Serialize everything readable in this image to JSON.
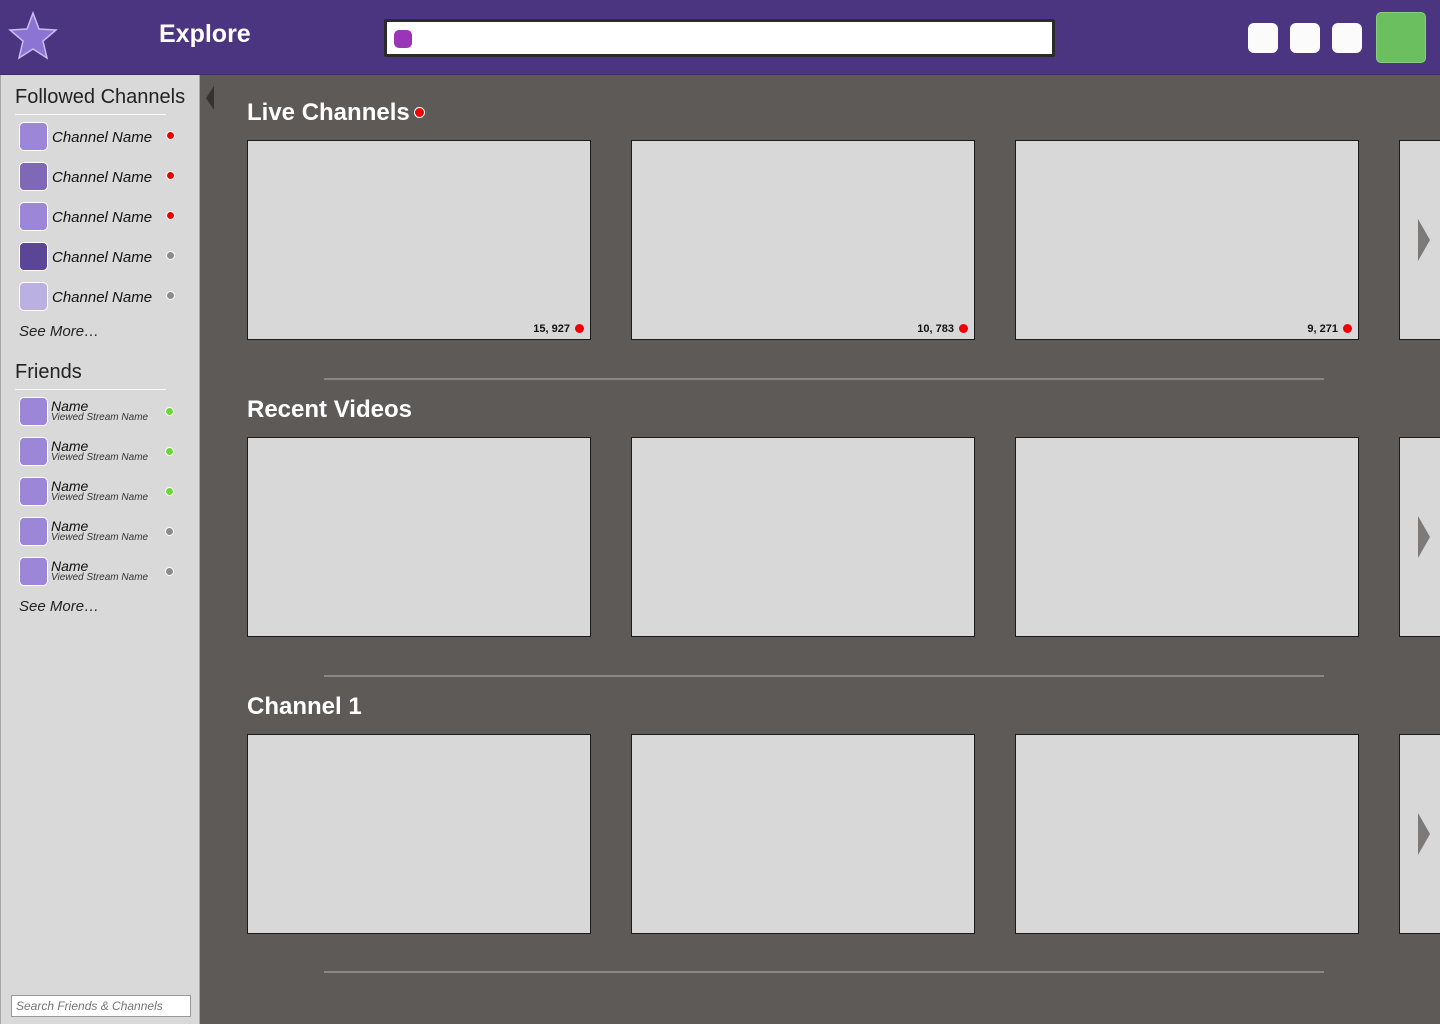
{
  "header": {
    "title": "Explore",
    "logo_icon": "star-icon",
    "search_value": "",
    "colors": {
      "bar": "#4b3580",
      "profile": "#6cbf5e",
      "search_dot": "#9a35b8"
    }
  },
  "sidebar": {
    "followed_title": "Followed Channels",
    "followed": [
      {
        "label": "Channel Name",
        "avatar_color": "#9b86d8",
        "status": "live"
      },
      {
        "label": "Channel Name",
        "avatar_color": "#7f68b8",
        "status": "live"
      },
      {
        "label": "Channel Name",
        "avatar_color": "#9b86d8",
        "status": "live"
      },
      {
        "label": "Channel Name",
        "avatar_color": "#5a4596",
        "status": "offline"
      },
      {
        "label": "Channel Name",
        "avatar_color": "#bbb0e2",
        "status": "offline"
      }
    ],
    "followed_see_more": "See More…",
    "friends_title": "Friends",
    "friends": [
      {
        "name": "Name",
        "sub": "Viewed Stream Name",
        "status": "online"
      },
      {
        "name": "Name",
        "sub": "Viewed Stream Name",
        "status": "online"
      },
      {
        "name": "Name",
        "sub": "Viewed Stream Name",
        "status": "online"
      },
      {
        "name": "Name",
        "sub": "Viewed Stream Name",
        "status": "offline"
      },
      {
        "name": "Name",
        "sub": "Viewed Stream Name",
        "status": "offline"
      }
    ],
    "friends_see_more": "See More…",
    "search_placeholder": "Search Friends & Channels"
  },
  "main": {
    "live_title": "Live Channels",
    "live_viewers": [
      "15, 927",
      "10, 783",
      "9, 271"
    ],
    "recent_title": "Recent Videos",
    "channel_title": "Channel 1"
  }
}
